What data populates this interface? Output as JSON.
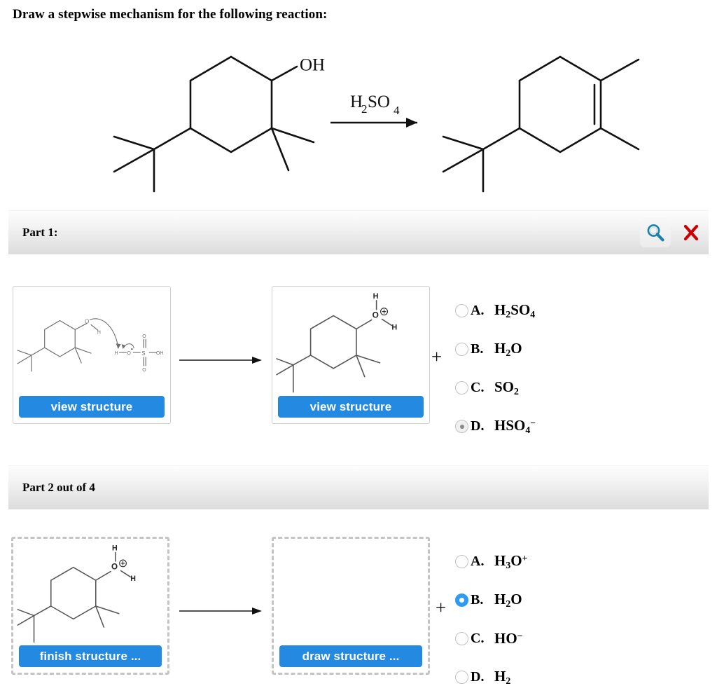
{
  "prompt": {
    "title": "Draw a stepwise mechanism for the following reaction:"
  },
  "scheme": {
    "reactant_label": "OH",
    "reagent": "H2SO4",
    "reagent_parts": {
      "h": "H",
      "h_sub": "2",
      "s": "SO",
      "s_sub": "4"
    },
    "arrow": "reaction-arrow"
  },
  "parts": [
    {
      "label": "Part 1:",
      "icons": [
        {
          "name": "magnifier-icon",
          "color": "#1b7fa8"
        },
        {
          "name": "close-x-icon",
          "color": "#cc0000"
        }
      ],
      "left_box": {
        "button_label": "view structure",
        "border": "solid",
        "structure": "protonation-with-arrows"
      },
      "right_box": {
        "button_label": "view structure",
        "border": "solid",
        "structure": "oxonium-ion"
      },
      "plus": "+",
      "choices": [
        {
          "letter": "A.",
          "formula_html": "H<sub>2</sub>SO<sub>4</sub>",
          "selected": false,
          "style": "gray"
        },
        {
          "letter": "B.",
          "formula_html": "H<sub>2</sub>O",
          "selected": false,
          "style": "gray"
        },
        {
          "letter": "C.",
          "formula_html": "SO<sub>2</sub>",
          "selected": false,
          "style": "gray"
        },
        {
          "letter": "D.",
          "formula_html": "HSO<sub>4</sub><sup>&#8722;</sup>",
          "selected": true,
          "style": "gray"
        }
      ]
    },
    {
      "label": "Part 2 out of 4",
      "icons": [],
      "left_box": {
        "button_label": "finish structure ...",
        "border": "dashed",
        "structure": "oxonium-ion"
      },
      "right_box": {
        "button_label": "draw structure ...",
        "border": "dashed",
        "structure": "empty"
      },
      "plus": "+",
      "choices": [
        {
          "letter": "A.",
          "formula_html": "H<sub>3</sub>O<sup>+</sup>",
          "selected": false,
          "style": "blue"
        },
        {
          "letter": "B.",
          "formula_html": "H<sub>2</sub>O",
          "selected": true,
          "style": "blue"
        },
        {
          "letter": "C.",
          "formula_html": "HO<sup>&#8722;</sup>",
          "selected": false,
          "style": "blue"
        },
        {
          "letter": "D.",
          "formula_html": "H<sub>2</sub>",
          "selected": false,
          "style": "blue"
        }
      ]
    }
  ],
  "colors": {
    "button_blue": "#2489e0",
    "radio_blue": "#2e9bf0",
    "x_red": "#cc0000",
    "magnifier_blue": "#1b7fa8",
    "bar_gray": "#e6e6e6",
    "structure_line": "#6f6f6f"
  }
}
